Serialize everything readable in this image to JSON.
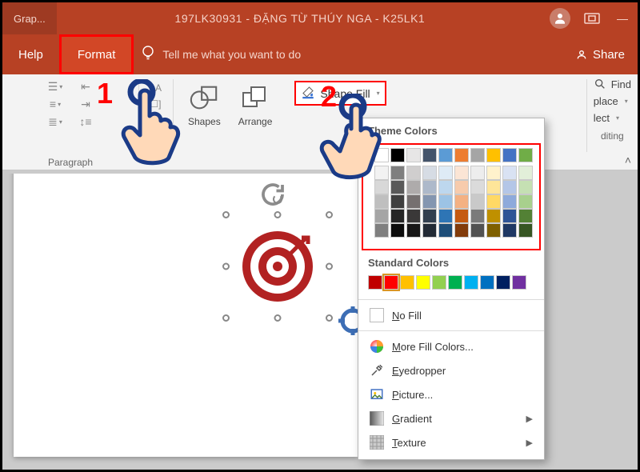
{
  "title": {
    "breadcrumb": "Grap...",
    "document": "197LK30931 - ĐẶNG TỪ THÚY NGA - K25LK1"
  },
  "tabs": {
    "help": "Help",
    "format": "Format",
    "tell_me": "Tell me what you want to do",
    "share": "Share"
  },
  "ribbon": {
    "paragraph_label": "Paragraph",
    "shapes": "Shapes",
    "arrange": "Arrange",
    "shape_fill": "Shape Fill",
    "find": "Find",
    "replace": "place",
    "select": "lect",
    "editing": "diting"
  },
  "dropdown": {
    "theme_heading": "Theme Colors",
    "standard_heading": "Standard Colors",
    "no_fill": "No Fill",
    "more_colors": "More Fill Colors...",
    "eyedropper": "Eyedropper",
    "picture": "Picture...",
    "gradient": "Gradient",
    "texture": "Texture",
    "theme_row1": [
      "#ffffff",
      "#000000",
      "#e7e6e6",
      "#44546a",
      "#5b9bd5",
      "#ed7d31",
      "#a5a5a5",
      "#ffc000",
      "#4472c4",
      "#70ad47"
    ],
    "theme_shades": [
      [
        "#f2f2f2",
        "#7f7f7f",
        "#d0cece",
        "#d6dce4",
        "#deebf6",
        "#fbe5d5",
        "#ededed",
        "#fff2cc",
        "#d9e2f3",
        "#e2efd9"
      ],
      [
        "#d8d8d8",
        "#595959",
        "#aeabab",
        "#adb9ca",
        "#bdd7ee",
        "#f7cbac",
        "#dbdbdb",
        "#fee599",
        "#b4c6e7",
        "#c5e0b3"
      ],
      [
        "#bfbfbf",
        "#3f3f3f",
        "#757070",
        "#8496b0",
        "#9cc3e5",
        "#f4b183",
        "#c9c9c9",
        "#ffd965",
        "#8eaadb",
        "#a8d08d"
      ],
      [
        "#a5a5a5",
        "#262626",
        "#3a3838",
        "#323f4f",
        "#2e75b5",
        "#c55a11",
        "#7b7b7b",
        "#bf9000",
        "#2f5496",
        "#538135"
      ],
      [
        "#7f7f7f",
        "#0c0c0c",
        "#171616",
        "#222a35",
        "#1e4e79",
        "#833c0b",
        "#525252",
        "#7f6000",
        "#1f3864",
        "#375623"
      ]
    ],
    "standard_row": [
      "#c00000",
      "#ff0000",
      "#ffc000",
      "#ffff00",
      "#92d050",
      "#00b050",
      "#00b0f0",
      "#0070c0",
      "#002060",
      "#7030a0"
    ]
  },
  "annotations": {
    "one": "1",
    "two": "2"
  }
}
